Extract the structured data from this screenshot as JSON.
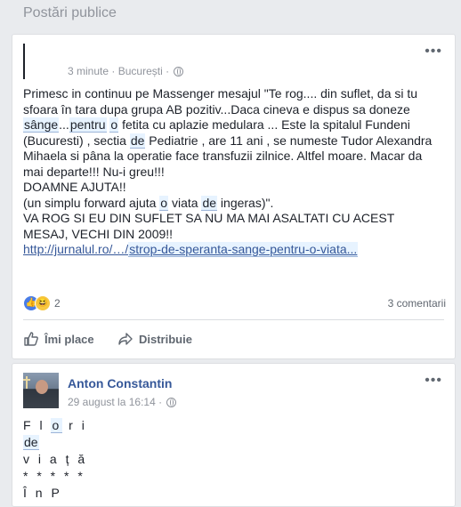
{
  "section": {
    "title": "Postări publice"
  },
  "post1": {
    "time": "3 minute",
    "separator": "·",
    "location": "București",
    "more_label": "•••",
    "lines": [
      "Primesc in continuu pe Massenger mesajul \"Te rog.... din suflet, da si tu",
      "sfoara în tara dupa grupa AB pozitiv...Daca cineva e dispus sa doneze",
      [
        "sânge",
        "...",
        "pentru",
        " ",
        "o",
        " fetita cu aplazie medulara ... Este la spitalul Fundeni"
      ],
      [
        "(Bucuresti) , sectia ",
        "de",
        " Pediatrie , are 11 ani , se numeste Tudor Alexandra"
      ],
      "Mihaela si pâna la operatie face transfuzii zilnice. Altfel moare. Macar da",
      "mai departe!!! Nu-i greu!!!",
      "DOAMNE AJUTA!!",
      [
        "(un simplu forward ajuta ",
        "o",
        " viata ",
        "de",
        " ingeras)\"."
      ],
      "VA ROG SI EU DIN SUFLET SA NU MA MAI ASALTATI CU ACEST",
      "MESAJ, VECHI DIN 2009!!"
    ],
    "link_prefix": "http://jurnalul.ro/…/",
    "link_rest": "strop-de-speranta-sange-pentru-o-viata...",
    "reaction_count": "2",
    "comments": "3 comentarii",
    "like_label": "Îmi place",
    "share_label": "Distribuie"
  },
  "post2": {
    "author": "Anton Constantin",
    "date": "29 august la 16:14",
    "separator": "·",
    "more_label": "•••",
    "poem_lines": [
      [
        "F l ",
        "o",
        " r i"
      ],
      [
        "",
        "de",
        ""
      ],
      [
        "v i a ț ă",
        "",
        ""
      ],
      [
        "* * * * *",
        "",
        ""
      ],
      [
        "Î n  P",
        "",
        ""
      ]
    ]
  },
  "colors": {
    "link": "#365899",
    "meta": "#90949c",
    "tag_bg": "#e7f3ff"
  }
}
